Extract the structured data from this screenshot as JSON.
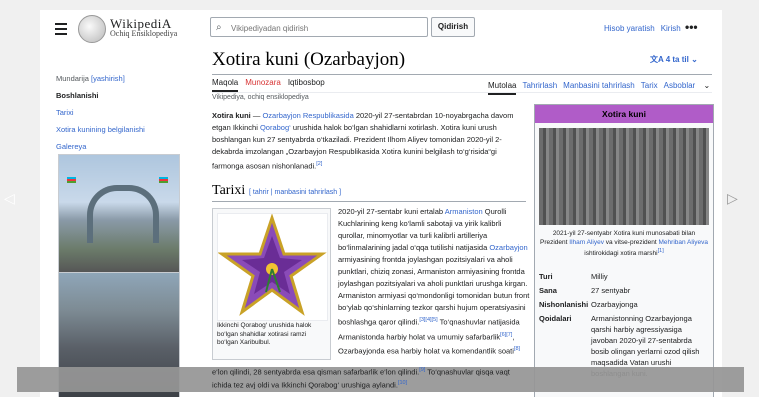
{
  "header": {
    "wordmark": "WikipediA",
    "tagline": "Ochiq Ensiklopediya",
    "search_placeholder": "Vikipediyadan qidirish",
    "search_button": "Qidirish",
    "create_account": "Hisob yaratish",
    "login": "Kirish",
    "more": "•••"
  },
  "article": {
    "title": "Xotira kuni (Ozarbayjon)",
    "languages": "4 ta til",
    "tabs_left": [
      "Maqola",
      "Munozara",
      "Iqtibosbop"
    ],
    "tabs_right": [
      "Mutolaa",
      "Tahrirlash",
      "Manbasini tahrirlash",
      "Tarix",
      "Asboblar"
    ],
    "from": "Vikipediya, ochiq ensiklopediya",
    "p1": {
      "b1": "Xotira kuni",
      "t1": " — ",
      "l1": "Ozarbayjon Respublikasida",
      "t2": " 2020-yil 27-sentabrdan 10-noyabrgacha davom etgan Ikkinchi ",
      "l2": "Qorabog‘",
      "t3": " urushida halok bo‘lgan shahidlarni xotirlash. Xotira kuni urush boshlangan kun 27 sentyabrda o‘tkaziladi. Prezident Ilhom Aliyev tomonidan 2020-yil 2-dekabrda imzolangan „Ozarbayjon Respublikasida Xotira kunini belgilash to‘g‘risida“gi farmonga asosan nishonlanadi.",
      "sup": "[2]"
    },
    "section_title": "Tarixi",
    "section_links": "[ tahrir | manbasini tahrirlash ]",
    "thumb_caption": "Ikkinchi Qorabog‘ urushida halok bo‘lgan shahidlar xotirasi ramzi bo‘lgan Xaribulbul.",
    "p2": {
      "t1": "2020-yil 27-sentabr kuni ertalab ",
      "l1": "Armaniston",
      "t2": " Qurolli Kuchlarining keng ko‘lamli sabotaji va yirik kalibrli qurollar, minomyotlar va turli kalibrli artilleriya bo‘linmalarining jadal o‘qqa tutilishi natijasida ",
      "l2": "Ozarbayjon",
      "t3": " armiyasining frontda joylashgan pozitsiyalari va aholi punktlari, chiziq zonasi, Armaniston armiyasining frontda joylashgan pozitsiyalari va aholi punktlari urushga kirgan. Armaniston armiyasi qo‘mondonligi tomonidan butun front bo‘ylab qo‘shinlarning tezkor qarshi hujum operatsiyasini boshlashga qaror qilindi.",
      "sup1": "[3][4][5]",
      "t4": " To‘qnashuvlar natijasida Armanistonda harbiy holat va umumiy safarbarlik",
      "sup2": "[6][7]",
      "t5": ", Ozarbayjonda esa harbiy holat va komendantlik soati",
      "sup3": "[8]"
    },
    "bottom_text": {
      "t1": "e‘lon qilindi, 28 sentyabrda esa qisman safarbarlik e‘lon qilindi.",
      "sup1": "[9]",
      "t2": " To‘qnashuvlar qisqa vaqt ichida tez avj oldi va Ikkinchi Qorabog‘ urushiga aylandi.",
      "sup2": "[10]"
    }
  },
  "sidebar": {
    "toc_head": "Mundarija",
    "toc_hide": "[yashirish]",
    "items": [
      "Boshlanishi",
      "Tarixi",
      "Xotira kunining belgilanishi",
      "Galereya"
    ]
  },
  "infobox": {
    "title": "Xotira kuni",
    "caption_1": "2021-yil 27-sentyabr Xotira kuni munosabati bilan Prezident ",
    "caption_l1": "Ilham Aliyev",
    "caption_2": " va vitse-prezident ",
    "caption_l2": "Mehriban Aliyeva",
    "caption_3": " ishtirokidagi xotira marshi",
    "caption_sup": "[1]",
    "rows": [
      {
        "k": "Turi",
        "v": "Milliy"
      },
      {
        "k": "Sana",
        "v": "27 sentyabr"
      },
      {
        "k": "Nishonlanishi",
        "v": "Ozarbayjonga"
      },
      {
        "k": "Qoidalari",
        "v": "Armanistonning Ozarbayjonga qarshi harbiy agressiyasiga javoban 2020-yil 27-sentabrda bosib olingan yerlarni ozod qilish maqsadida Vatan urushi boshlangan kuni."
      }
    ]
  },
  "colors": {
    "link": "#3366cc",
    "infobox_header": "#b05cc8",
    "popup_overlay": "#969696"
  }
}
